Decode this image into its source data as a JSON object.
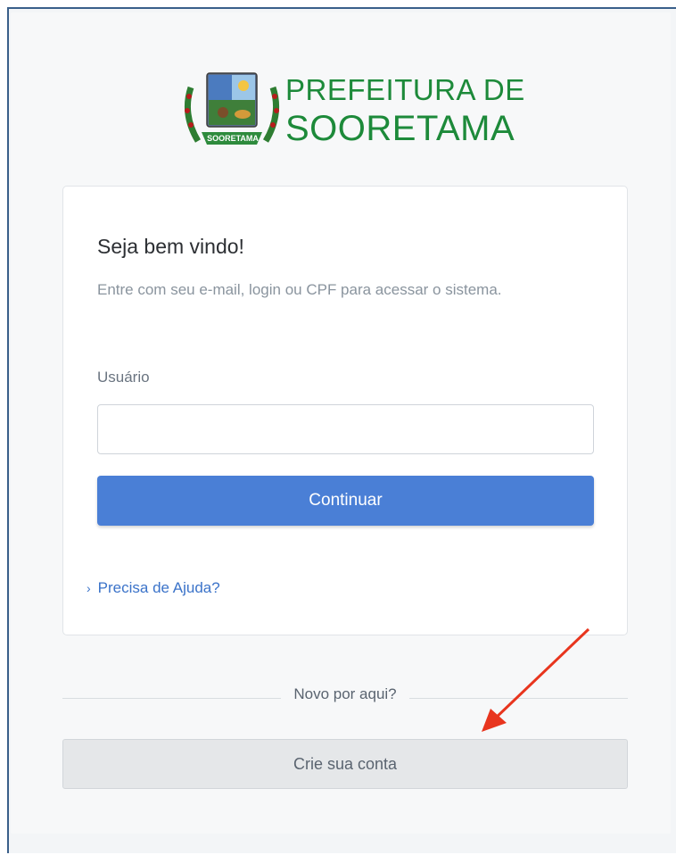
{
  "header": {
    "logo_line1": "PREFEITURA DE",
    "logo_line2": "SOORETAMA",
    "emblem_text": "SOORETAMA"
  },
  "login": {
    "title": "Seja bem vindo!",
    "subtitle": "Entre com seu e-mail, login ou CPF para acessar o sistema.",
    "user_label": "Usuário",
    "user_value": "",
    "user_placeholder": "",
    "continue_label": "Continuar",
    "help_label": "Precisa de Ajuda?"
  },
  "signup": {
    "divider_text": "Novo por aqui?",
    "create_label": "Crie sua conta"
  },
  "colors": {
    "primary": "#4a7fd6",
    "brand_green": "#1d8a3a",
    "link": "#3b73c9",
    "annotation_arrow": "#e8351e"
  }
}
